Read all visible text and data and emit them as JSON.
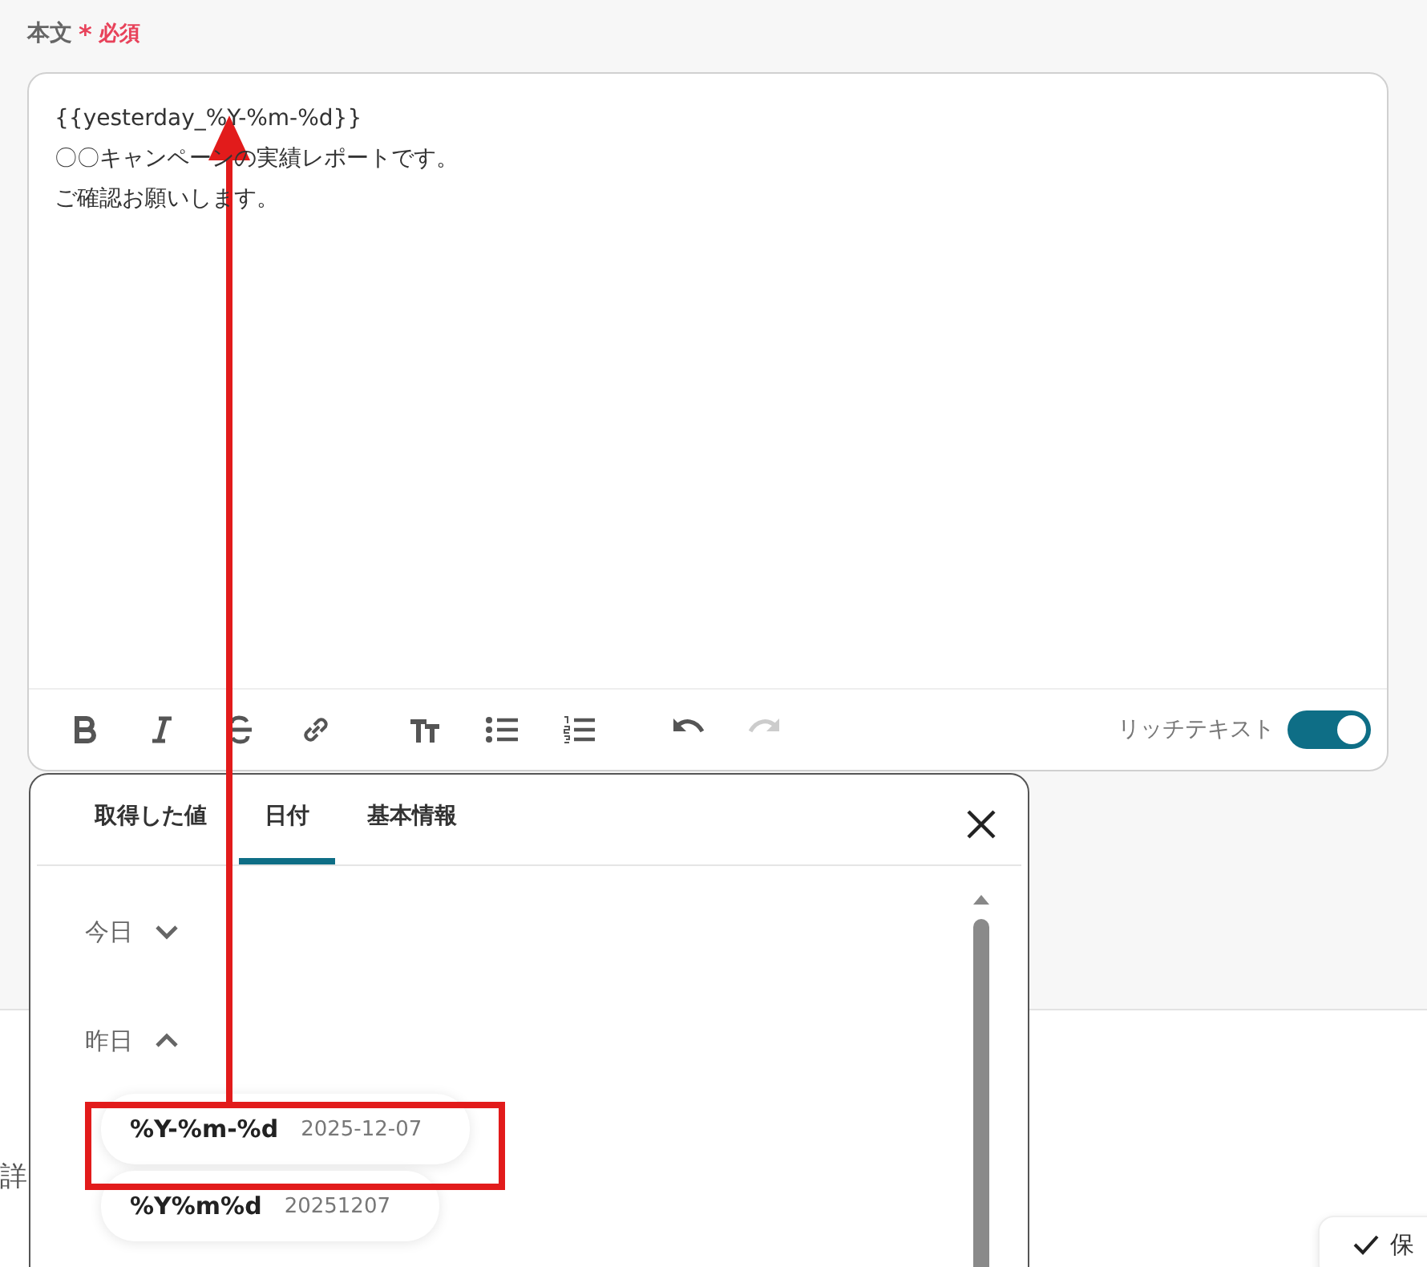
{
  "field": {
    "label": "本文",
    "required_mark": "*",
    "required_label": "必須"
  },
  "editor": {
    "lines": [
      "{{yesterday_%Y-%m-%d}}",
      "〇〇キャンペーンの実績レポートです。",
      "ご確認お願いします。"
    ],
    "toolbar": [
      {
        "kind": "bold",
        "disabled": false
      },
      {
        "kind": "italic",
        "disabled": false
      },
      {
        "kind": "strike",
        "disabled": false
      },
      {
        "kind": "link",
        "disabled": false
      },
      {
        "kind": "textsize",
        "disabled": false
      },
      {
        "kind": "bullets",
        "disabled": false
      },
      {
        "kind": "numbers",
        "disabled": false
      },
      {
        "kind": "undo",
        "disabled": false
      },
      {
        "kind": "redo",
        "disabled": true
      }
    ],
    "rich_text": {
      "label": "リッチテキスト",
      "on": true
    }
  },
  "popover": {
    "tabs": [
      {
        "label": "取得した値",
        "selected": false
      },
      {
        "label": "日付",
        "selected": true
      },
      {
        "label": "基本情報",
        "selected": false
      }
    ],
    "groups": [
      {
        "label": "今日",
        "expanded": false
      },
      {
        "label": "昨日",
        "expanded": true,
        "items": [
          {
            "format": "%Y-%m-%d",
            "example": "2025-12-07"
          },
          {
            "format": "%Y%m%d",
            "example": "20251207"
          }
        ]
      }
    ]
  },
  "background": {
    "side_text": "詳",
    "save_button": "保"
  }
}
